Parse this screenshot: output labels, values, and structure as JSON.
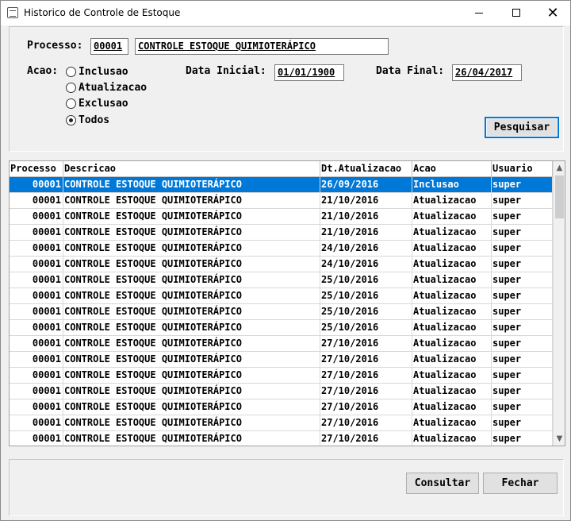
{
  "window": {
    "title": "Historico de Controle de Estoque",
    "controls": {
      "minimize": "minimize",
      "maximize": "maximize",
      "close": "✕"
    }
  },
  "filters": {
    "processo_label": "Processo:",
    "processo_code": "00001",
    "processo_desc": "CONTROLE ESTOQUE QUIMIOTERÁPICO",
    "acao_label": "Acao:",
    "acao_options": [
      {
        "label": "Inclusao",
        "checked": false
      },
      {
        "label": "Atualizacao",
        "checked": false
      },
      {
        "label": "Exclusao",
        "checked": false
      },
      {
        "label": "Todos",
        "checked": true
      }
    ],
    "data_inicial_label": "Data Inicial:",
    "data_inicial_value": "01/01/1900",
    "data_final_label": "Data Final:",
    "data_final_value": "26/04/2017",
    "search_button": "Pesquisar"
  },
  "grid": {
    "columns": [
      "Processo",
      "Descricao",
      "Dt.Atualizacao",
      "Acao",
      "Usuario"
    ],
    "rows": [
      {
        "processo": "00001",
        "descricao": "CONTROLE ESTOQUE QUIMIOTERÁPICO",
        "data": "26/09/2016",
        "acao": "Inclusao",
        "usuario": "super",
        "selected": true
      },
      {
        "processo": "00001",
        "descricao": "CONTROLE ESTOQUE QUIMIOTERÁPICO",
        "data": "21/10/2016",
        "acao": "Atualizacao",
        "usuario": "super"
      },
      {
        "processo": "00001",
        "descricao": "CONTROLE ESTOQUE QUIMIOTERÁPICO",
        "data": "21/10/2016",
        "acao": "Atualizacao",
        "usuario": "super"
      },
      {
        "processo": "00001",
        "descricao": "CONTROLE ESTOQUE QUIMIOTERÁPICO",
        "data": "21/10/2016",
        "acao": "Atualizacao",
        "usuario": "super"
      },
      {
        "processo": "00001",
        "descricao": "CONTROLE ESTOQUE QUIMIOTERÁPICO",
        "data": "24/10/2016",
        "acao": "Atualizacao",
        "usuario": "super"
      },
      {
        "processo": "00001",
        "descricao": "CONTROLE ESTOQUE QUIMIOTERÁPICO",
        "data": "24/10/2016",
        "acao": "Atualizacao",
        "usuario": "super"
      },
      {
        "processo": "00001",
        "descricao": "CONTROLE ESTOQUE QUIMIOTERÁPICO",
        "data": "25/10/2016",
        "acao": "Atualizacao",
        "usuario": "super"
      },
      {
        "processo": "00001",
        "descricao": "CONTROLE ESTOQUE QUIMIOTERÁPICO",
        "data": "25/10/2016",
        "acao": "Atualizacao",
        "usuario": "super"
      },
      {
        "processo": "00001",
        "descricao": "CONTROLE ESTOQUE QUIMIOTERÁPICO",
        "data": "25/10/2016",
        "acao": "Atualizacao",
        "usuario": "super"
      },
      {
        "processo": "00001",
        "descricao": "CONTROLE ESTOQUE QUIMIOTERÁPICO",
        "data": "25/10/2016",
        "acao": "Atualizacao",
        "usuario": "super"
      },
      {
        "processo": "00001",
        "descricao": "CONTROLE ESTOQUE QUIMIOTERÁPICO",
        "data": "27/10/2016",
        "acao": "Atualizacao",
        "usuario": "super"
      },
      {
        "processo": "00001",
        "descricao": "CONTROLE ESTOQUE QUIMIOTERÁPICO",
        "data": "27/10/2016",
        "acao": "Atualizacao",
        "usuario": "super"
      },
      {
        "processo": "00001",
        "descricao": "CONTROLE ESTOQUE QUIMIOTERÁPICO",
        "data": "27/10/2016",
        "acao": "Atualizacao",
        "usuario": "super"
      },
      {
        "processo": "00001",
        "descricao": "CONTROLE ESTOQUE QUIMIOTERÁPICO",
        "data": "27/10/2016",
        "acao": "Atualizacao",
        "usuario": "super"
      },
      {
        "processo": "00001",
        "descricao": "CONTROLE ESTOQUE QUIMIOTERÁPICO",
        "data": "27/10/2016",
        "acao": "Atualizacao",
        "usuario": "super"
      },
      {
        "processo": "00001",
        "descricao": "CONTROLE ESTOQUE QUIMIOTERÁPICO",
        "data": "27/10/2016",
        "acao": "Atualizacao",
        "usuario": "super"
      },
      {
        "processo": "00001",
        "descricao": "CONTROLE ESTOQUE QUIMIOTERÁPICO",
        "data": "27/10/2016",
        "acao": "Atualizacao",
        "usuario": "super"
      }
    ],
    "scroll_up_icon": "chevron-up-icon",
    "scroll_down_icon": "chevron-down-icon"
  },
  "footer": {
    "consultar_button": "Consultar",
    "fechar_button": "Fechar"
  },
  "colors": {
    "selection": "#0078d7",
    "window_bg": "#f0f0f0",
    "focus_border": "#0078d7"
  }
}
